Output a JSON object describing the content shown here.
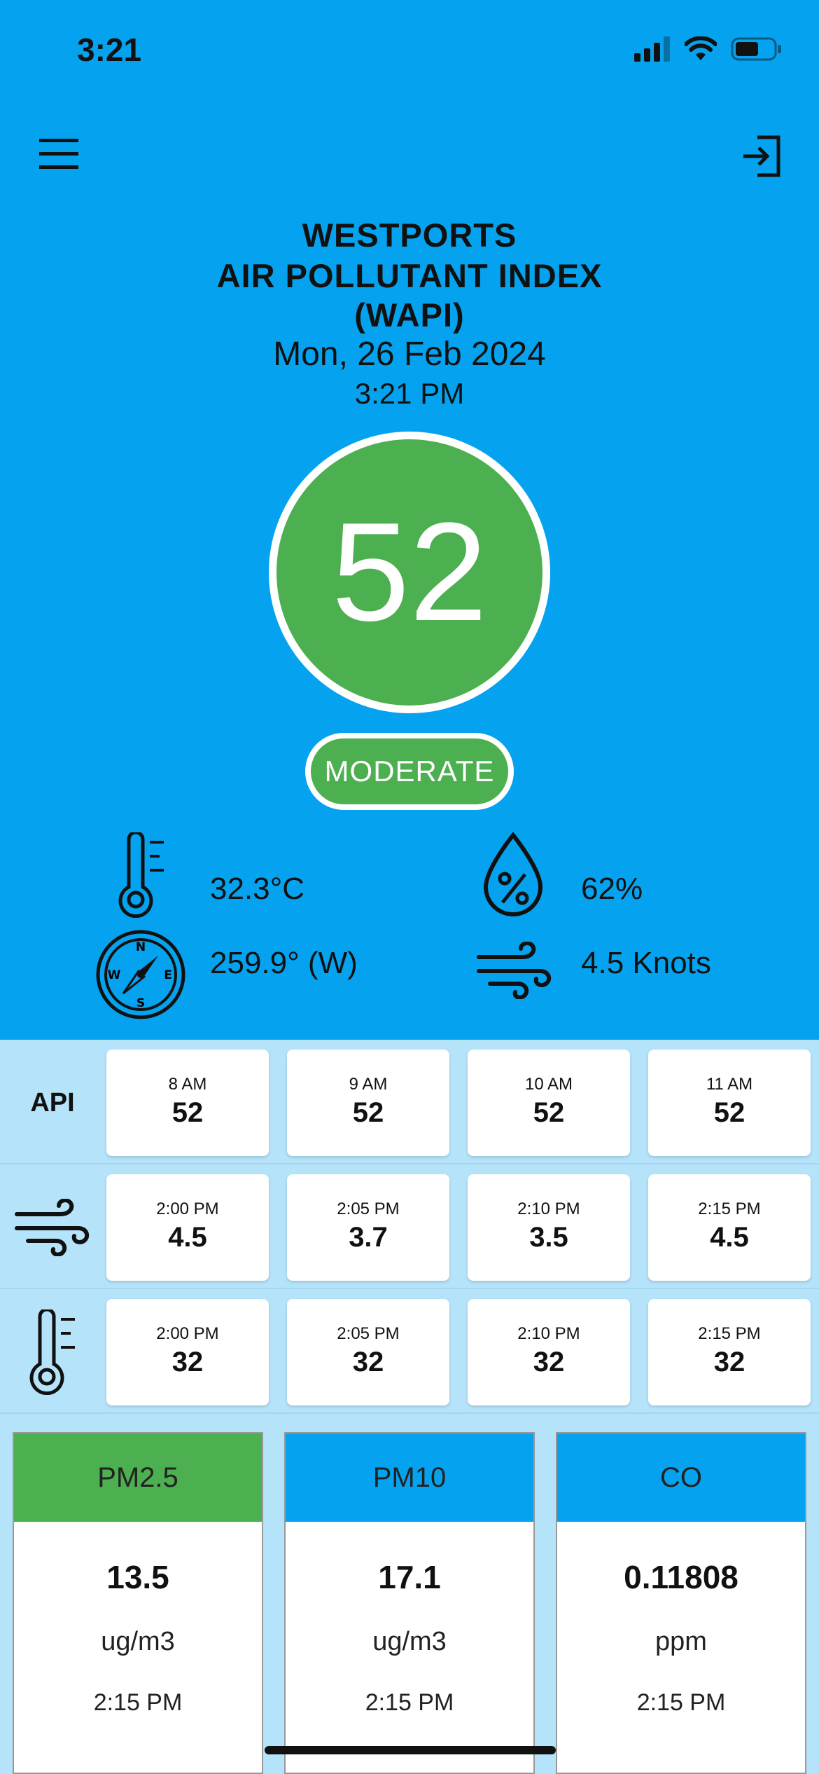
{
  "status_bar": {
    "time": "3:21"
  },
  "header": {
    "title_line1": "WESTPORTS",
    "title_line2": "AIR POLLUTANT INDEX",
    "title_line3": "(WAPI)",
    "date": "Mon, 26 Feb 2024",
    "time": "3:21 PM"
  },
  "index": {
    "value": "52",
    "category": "MODERATE",
    "color": "#4caf50"
  },
  "weather": {
    "temperature": "32.3°C",
    "humidity": "62%",
    "wind_direction": "259.9° (W)",
    "wind_speed": "4.5 Knots"
  },
  "api_row": {
    "label": "API",
    "cells": [
      {
        "time": "8 AM",
        "value": "52"
      },
      {
        "time": "9 AM",
        "value": "52"
      },
      {
        "time": "10 AM",
        "value": "52"
      },
      {
        "time": "11 AM",
        "value": "52"
      }
    ]
  },
  "wind_row": {
    "icon": "wind-icon",
    "cells": [
      {
        "time": "2:00 PM",
        "value": "4.5"
      },
      {
        "time": "2:05 PM",
        "value": "3.7"
      },
      {
        "time": "2:10 PM",
        "value": "3.5"
      },
      {
        "time": "2:15 PM",
        "value": "4.5"
      }
    ]
  },
  "temp_row": {
    "icon": "thermometer-icon",
    "cells": [
      {
        "time": "2:00 PM",
        "value": "32"
      },
      {
        "time": "2:05 PM",
        "value": "32"
      },
      {
        "time": "2:10 PM",
        "value": "32"
      },
      {
        "time": "2:15 PM",
        "value": "32"
      }
    ]
  },
  "pollutants": [
    {
      "name": "PM2.5",
      "value": "13.5",
      "unit": "ug/m3",
      "time": "2:15 PM",
      "color": "#4caf50"
    },
    {
      "name": "PM10",
      "value": "17.1",
      "unit": "ug/m3",
      "time": "2:15 PM",
      "color": "#05a3ef"
    },
    {
      "name": "CO",
      "value": "0.11808",
      "unit": "ppm",
      "time": "2:15 PM",
      "color": "#05a3ef"
    }
  ],
  "colors": {
    "background": "#05a3ef",
    "table_background": "#b5e3fa",
    "good": "#4caf50"
  }
}
